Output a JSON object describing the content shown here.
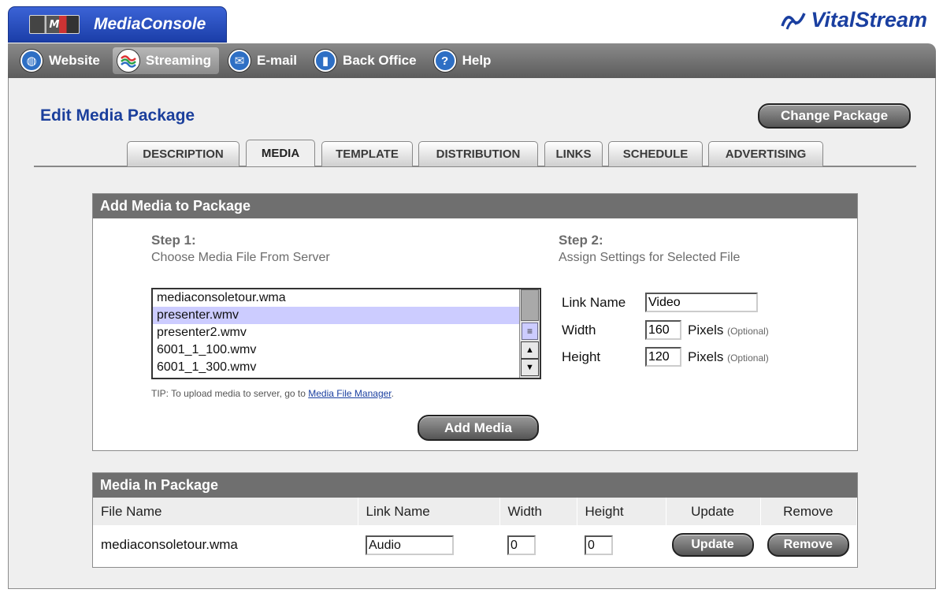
{
  "app": {
    "logo_text": "M",
    "title": "MediaConsole",
    "vendor_logo": "VitalStream"
  },
  "nav": {
    "items": [
      {
        "label": "Website",
        "icon": "globe-icon",
        "color": "#2e6fc4"
      },
      {
        "label": "Streaming",
        "icon": "stream-waves-icon",
        "color": "#2a9f47",
        "active": true
      },
      {
        "label": "E-mail",
        "icon": "envelope-icon",
        "color": "#2e6fc4"
      },
      {
        "label": "Back Office",
        "icon": "bar-chart-icon",
        "color": "#2e6fc4"
      },
      {
        "label": "Help",
        "icon": "help-question-icon",
        "color": "#2e6fc4"
      }
    ]
  },
  "page": {
    "title": "Edit Media Package",
    "change_package": "Change Package"
  },
  "tabs": [
    "DESCRIPTION",
    "MEDIA",
    "TEMPLATE",
    "DISTRIBUTION",
    "LINKS",
    "SCHEDULE",
    "ADVERTISING"
  ],
  "active_tab": "MEDIA",
  "add_media": {
    "header": "Add Media to Package",
    "step1_title": "Step 1:",
    "step1_sub": "Choose Media File From Server",
    "step2_title": "Step 2:",
    "step2_sub": "Assign Settings for Selected File",
    "files": [
      "mediaconsoletour.wma",
      "presenter.wmv",
      "presenter2.wmv",
      "6001_1_100.wmv",
      "6001_1_300.wmv"
    ],
    "selected_file": "presenter.wmv",
    "tip_prefix": "TIP: To upload media to server, go to ",
    "tip_link": "Media File Manager",
    "tip_suffix": ".",
    "button": "Add Media",
    "link_name_label": "Link Name",
    "link_name_value": "Video",
    "width_label": "Width",
    "width_value": "160",
    "height_label": "Height",
    "height_value": "120",
    "pixels": "Pixels",
    "optional": "(Optional)"
  },
  "media_in_package": {
    "header": "Media In Package",
    "columns": [
      "File Name",
      "Link Name",
      "Width",
      "Height",
      "Update",
      "Remove"
    ],
    "rows": [
      {
        "file": "mediaconsoletour.wma",
        "link_name": "Audio",
        "width": "0",
        "height": "0",
        "update": "Update",
        "remove": "Remove"
      }
    ]
  }
}
